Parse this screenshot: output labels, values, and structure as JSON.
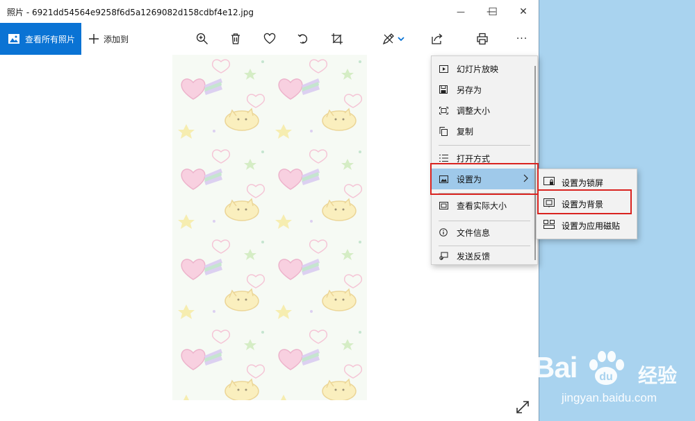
{
  "window": {
    "title": "照片 - 6921dd54564e9258f6d5a1269082d158cdbf4e12.jpg",
    "minimize_glyph": "—",
    "maximize_glyph": "☐",
    "close_glyph": "✕"
  },
  "toolbar": {
    "view_all_label": "查看所有照片",
    "add_label": "添加到",
    "more_glyph": "···",
    "icons": [
      "zoom-in-icon",
      "delete-icon",
      "heart-icon",
      "rotate-icon",
      "crop-icon",
      "edit-icon",
      "share-icon",
      "print-icon",
      "more-icon"
    ]
  },
  "menu": {
    "items": [
      {
        "label": "幻灯片放映",
        "icon": "slideshow-icon"
      },
      {
        "label": "另存为",
        "icon": "save-icon"
      },
      {
        "label": "调整大小",
        "icon": "resize-icon"
      },
      {
        "label": "复制",
        "icon": "copy-icon"
      },
      {
        "label": "打开方式",
        "icon": "open-with-icon"
      },
      {
        "label": "设置为",
        "icon": "set-as-icon"
      },
      {
        "label": "查看实际大小",
        "icon": "actual-size-icon"
      },
      {
        "label": "文件信息",
        "icon": "info-icon"
      },
      {
        "label": "发送反馈",
        "icon": "feedback-icon"
      }
    ]
  },
  "submenu": {
    "items": [
      {
        "label": "设置为锁屏",
        "icon": "lock-screen-icon"
      },
      {
        "label": "设置为背景",
        "icon": "background-icon"
      },
      {
        "label": "设置为应用磁贴",
        "icon": "tile-icon"
      }
    ]
  },
  "watermark": {
    "brand": "Bai",
    "brand_cn": "经验",
    "url": "jingyan.baidu.com"
  },
  "colors": {
    "accent": "#0a73d4",
    "highlight": "#d9231f",
    "menu_active": "#9fc9ea",
    "desktop": "#a9d3ef"
  }
}
